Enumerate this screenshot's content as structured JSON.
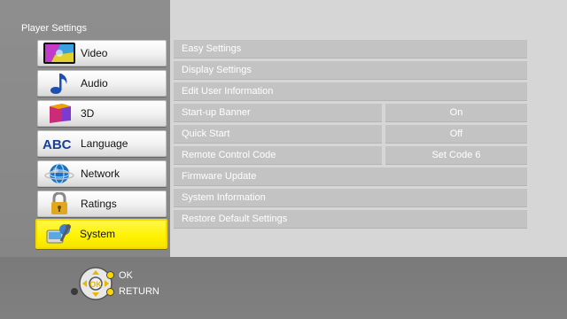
{
  "panel_title": "Player Settings",
  "categories": [
    {
      "label": "Video",
      "icon": "video-icon"
    },
    {
      "label": "Audio",
      "icon": "music-note-icon"
    },
    {
      "label": "3D",
      "icon": "3d-cube-icon"
    },
    {
      "label": "Language",
      "icon": "abc-icon"
    },
    {
      "label": "Network",
      "icon": "globe-icon"
    },
    {
      "label": "Ratings",
      "icon": "padlock-icon"
    },
    {
      "label": "System",
      "icon": "system-icon",
      "selected": true
    }
  ],
  "settings": [
    {
      "label": "Easy Settings"
    },
    {
      "label": "Display Settings"
    },
    {
      "label": "Edit User Information"
    },
    {
      "label": "Start-up Banner",
      "value": "On"
    },
    {
      "label": "Quick Start",
      "value": "Off"
    },
    {
      "label": "Remote Control Code",
      "value": "Set Code 6"
    },
    {
      "label": "Firmware Update"
    },
    {
      "label": "System Information"
    },
    {
      "label": "Restore Default Settings"
    }
  ],
  "footer": {
    "ok_label": "OK",
    "return_label": "RETURN",
    "dpad_icon": "dpad-icon"
  },
  "colors": {
    "selected": "#fff200",
    "left_panel": "#8a8a8a",
    "right_panel": "#d6d6d6",
    "row": "#c3c3c3"
  }
}
